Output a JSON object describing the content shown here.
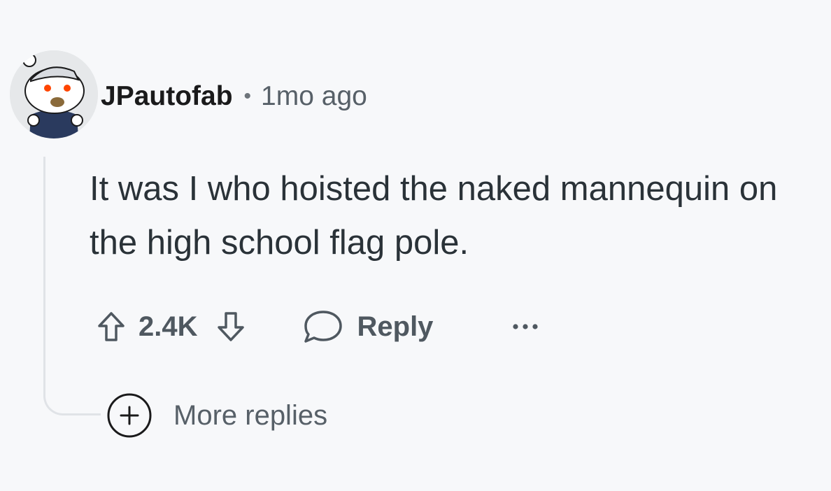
{
  "comment": {
    "username": "JPautofab",
    "separator": "•",
    "timestamp": "1mo ago",
    "body": "It was I who hoisted the naked mannequin on the high school flag pole.",
    "score": "2.4K",
    "reply_label": "Reply",
    "more_replies_label": "More replies"
  },
  "icons": {
    "avatar": "reddit-snoo-avatar",
    "upvote": "upvote-arrow-icon",
    "downvote": "downvote-arrow-icon",
    "reply": "speech-bubble-icon",
    "more": "ellipsis-icon",
    "expand": "plus-circle-icon"
  },
  "colors": {
    "background": "#f7f8fa",
    "text_primary": "#1a1a1b",
    "text_secondary": "#4f5860",
    "thread_line": "#e0e3e7"
  }
}
